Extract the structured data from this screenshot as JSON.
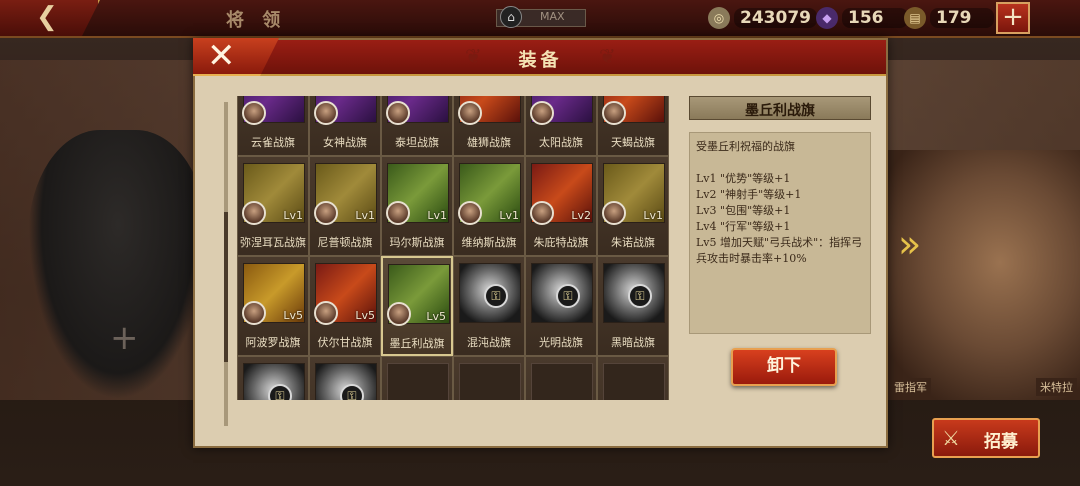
{
  "topbar": {
    "title": "将 领",
    "max_label": "MAX",
    "resources": [
      {
        "icon": "coin-icon",
        "value": "243079",
        "color": "#8a7a5a"
      },
      {
        "icon": "gem-icon",
        "value": "156",
        "color": "#6a3aa0"
      },
      {
        "icon": "scroll-icon",
        "value": "179",
        "color": "#a88a4a"
      }
    ],
    "plus_label": "+"
  },
  "modal": {
    "title": "装备",
    "close_label": "✕"
  },
  "grid": {
    "cells": [
      {
        "name": "云雀战旗",
        "level": "",
        "flag": "purple",
        "portrait": true
      },
      {
        "name": "女神战旗",
        "level": "",
        "flag": "purple",
        "portrait": true
      },
      {
        "name": "泰坦战旗",
        "level": "",
        "flag": "purple",
        "portrait": true
      },
      {
        "name": "雄狮战旗",
        "level": "",
        "flag": "red",
        "portrait": true
      },
      {
        "name": "太阳战旗",
        "level": "",
        "flag": "purple",
        "portrait": true
      },
      {
        "name": "天蝎战旗",
        "level": "",
        "flag": "red",
        "portrait": true
      },
      {
        "name": "弥涅耳瓦战旗",
        "level": "Lv1",
        "flag": "gold",
        "portrait": true
      },
      {
        "name": "尼普顿战旗",
        "level": "Lv1",
        "flag": "gold",
        "portrait": true
      },
      {
        "name": "玛尔斯战旗",
        "level": "Lv1",
        "flag": "green",
        "portrait": true
      },
      {
        "name": "维纳斯战旗",
        "level": "Lv1",
        "flag": "green",
        "portrait": true
      },
      {
        "name": "朱庇特战旗",
        "level": "Lv2",
        "flag": "red",
        "portrait": true
      },
      {
        "name": "朱诺战旗",
        "level": "Lv1",
        "flag": "gold",
        "portrait": true
      },
      {
        "name": "阿波罗战旗",
        "level": "Lv5",
        "flag": "orange",
        "portrait": true
      },
      {
        "name": "伏尔甘战旗",
        "level": "Lv5",
        "flag": "red",
        "portrait": true
      },
      {
        "name": "墨丘利战旗",
        "level": "Lv5",
        "flag": "green",
        "portrait": true,
        "selected": true
      },
      {
        "name": "混沌战旗",
        "level": "",
        "flag": "lock",
        "portrait": false
      },
      {
        "name": "光明战旗",
        "level": "",
        "flag": "lock",
        "portrait": false
      },
      {
        "name": "黑暗战旗",
        "level": "",
        "flag": "lock",
        "portrait": false
      },
      {
        "name": "",
        "level": "",
        "flag": "lock",
        "portrait": false
      },
      {
        "name": "",
        "level": "",
        "flag": "lock",
        "portrait": false
      },
      {
        "name": "",
        "level": "",
        "flag": "empty",
        "portrait": false
      },
      {
        "name": "",
        "level": "",
        "flag": "empty",
        "portrait": false
      },
      {
        "name": "",
        "level": "",
        "flag": "empty",
        "portrait": false
      },
      {
        "name": "",
        "level": "",
        "flag": "empty",
        "portrait": false
      }
    ]
  },
  "detail": {
    "title": "墨丘利战旗",
    "lines": [
      "受墨丘利祝福的战旗",
      "",
      "Lv1 \"优势\"等级+1",
      "Lv2 \"神射手\"等级+1",
      "Lv3 \"包围\"等级+1",
      "Lv4 \"行军\"等级+1",
      "Lv5 增加天赋\"弓兵战术\"：指挥弓兵攻击时暴击率+10%"
    ],
    "unequip_label": "卸下"
  },
  "background": {
    "general_labels": [
      "雷指军",
      "米特拉"
    ],
    "silhouette_plus": "+",
    "next_arrow": "»"
  },
  "recruit": {
    "label": "招募"
  }
}
